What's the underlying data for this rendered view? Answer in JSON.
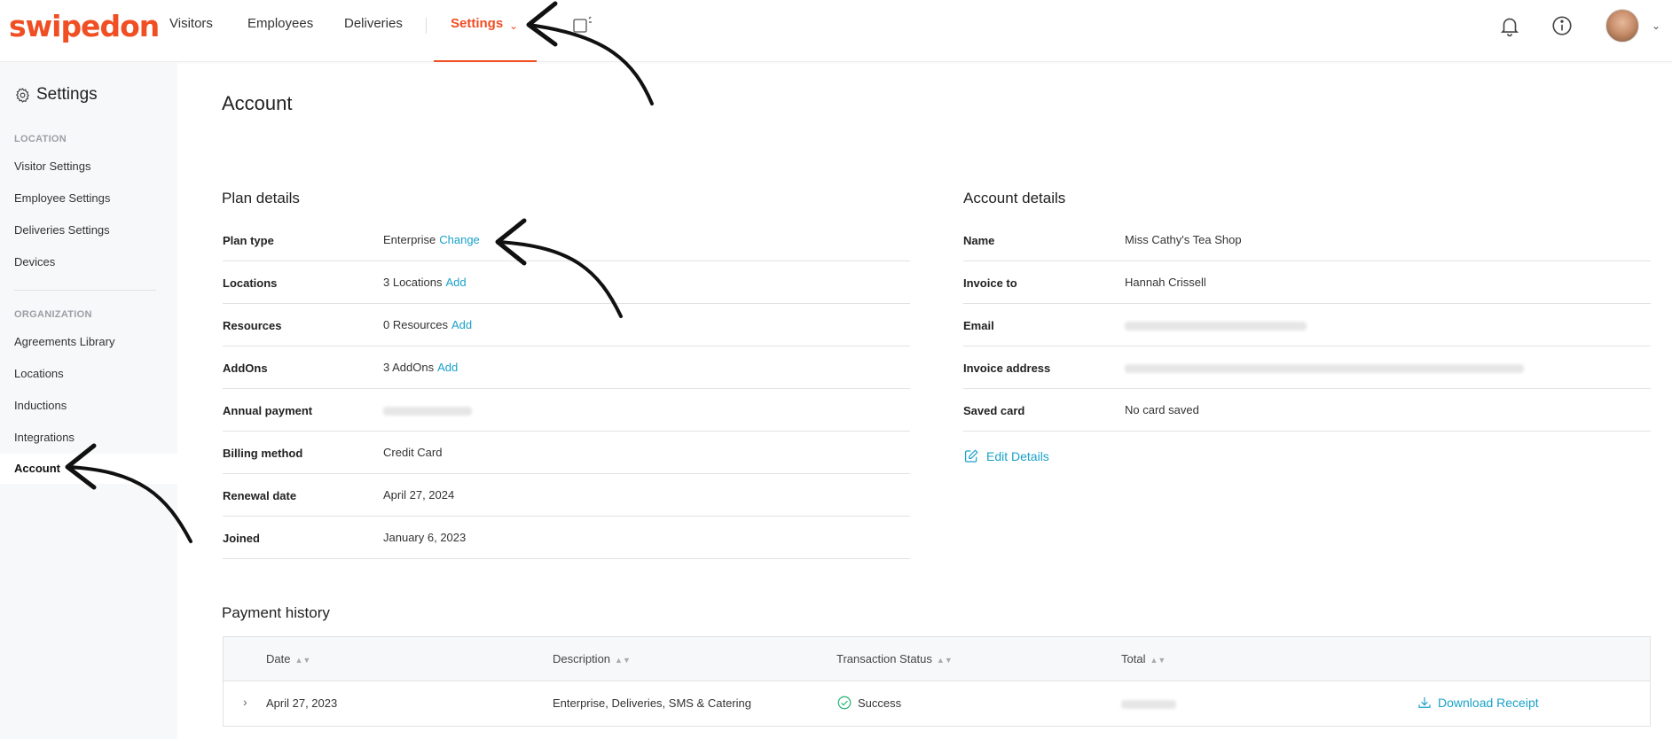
{
  "brand": {
    "logo": "swipedon",
    "brand_color": "#f04e23",
    "link_color": "#1aa1c9"
  },
  "topnav": {
    "items": [
      "Visitors",
      "Employees",
      "Deliveries"
    ],
    "active": "Settings"
  },
  "sidebar": {
    "title": "Settings",
    "location_section": "LOCATION",
    "location_items": [
      "Visitor Settings",
      "Employee Settings",
      "Deliveries Settings",
      "Devices"
    ],
    "organization_section": "ORGANIZATION",
    "organization_items": [
      "Agreements Library",
      "Locations",
      "Inductions",
      "Integrations"
    ],
    "active_item": "Account"
  },
  "page": {
    "title": "Account"
  },
  "plan": {
    "title": "Plan details",
    "rows": [
      {
        "label": "Plan type",
        "value": "Enterprise",
        "action": "Change"
      },
      {
        "label": "Locations",
        "value": "3 Locations",
        "action": "Add"
      },
      {
        "label": "Resources",
        "value": "0 Resources",
        "action": "Add"
      },
      {
        "label": "AddOns",
        "value": "3 AddOns",
        "action": "Add"
      },
      {
        "label": "Annual payment"
      },
      {
        "label": "Billing method",
        "value": "Credit Card"
      },
      {
        "label": "Renewal date",
        "value": "April 27, 2024"
      },
      {
        "label": "Joined",
        "value": "January 6, 2023"
      }
    ]
  },
  "account": {
    "title": "Account details",
    "rows": [
      {
        "label": "Name",
        "value": "Miss Cathy's Tea Shop"
      },
      {
        "label": "Invoice to",
        "value": "Hannah Crissell"
      },
      {
        "label": "Email"
      },
      {
        "label": "Invoice address"
      },
      {
        "label": "Saved card",
        "value": "No card saved"
      }
    ],
    "edit_label": "Edit Details"
  },
  "payments": {
    "title": "Payment history",
    "columns": [
      "Date",
      "Description",
      "Transaction Status",
      "Total"
    ],
    "rows": [
      {
        "date": "April 27, 2023",
        "description": "Enterprise, Deliveries, SMS & Catering",
        "status": "Success",
        "action": "Download Receipt"
      }
    ]
  }
}
